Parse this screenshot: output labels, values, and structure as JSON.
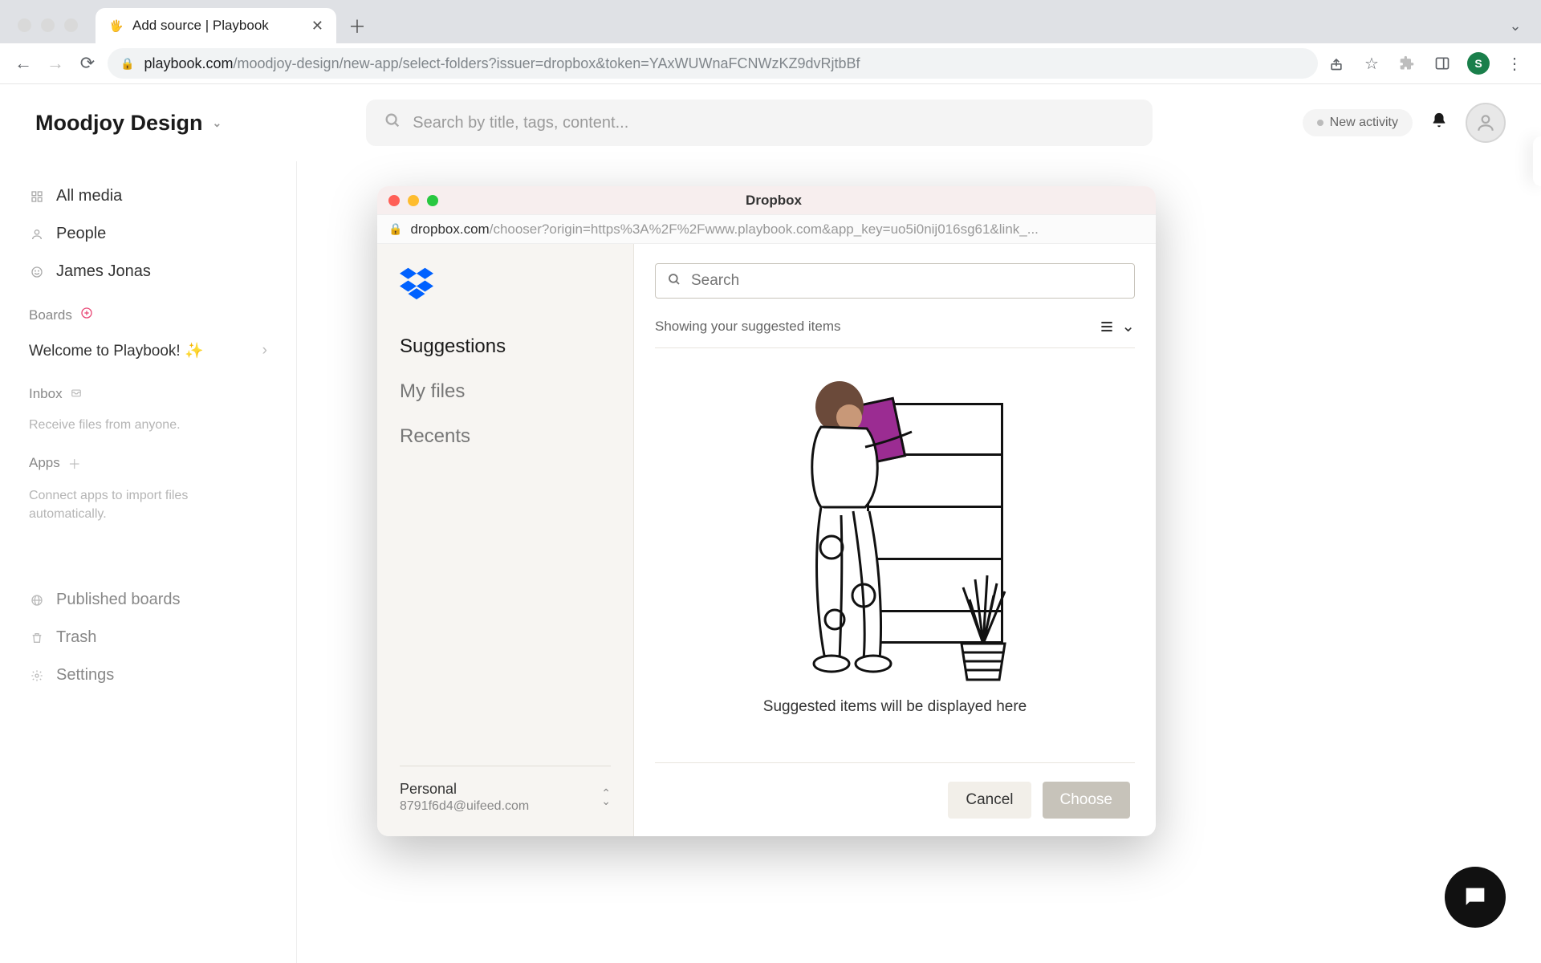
{
  "browser": {
    "tab_title": "Add source | Playbook",
    "url_host": "playbook.com",
    "url_path": "/moodjoy-design/new-app/select-folders?issuer=dropbox&token=YAxWUWnaFCNWzKZ9dvRjtbBf",
    "profile_initial": "S"
  },
  "header": {
    "workspace": "Moodjoy Design",
    "search_placeholder": "Search by title, tags, content...",
    "activity_label": "New activity"
  },
  "sidebar": {
    "items": [
      {
        "icon": "grid",
        "label": "All media"
      },
      {
        "icon": "person",
        "label": "People"
      },
      {
        "icon": "circle",
        "label": "James Jonas"
      }
    ],
    "boards_label": "Boards",
    "board_welcome": "Welcome to Playbook! ✨",
    "inbox_label": "Inbox",
    "inbox_sub": "Receive files from anyone.",
    "apps_label": "Apps",
    "apps_sub": "Connect apps to import files automatically.",
    "bottom": [
      {
        "icon": "globe",
        "label": "Published boards"
      },
      {
        "icon": "trash",
        "label": "Trash"
      },
      {
        "icon": "gear",
        "label": "Settings"
      }
    ]
  },
  "modal": {
    "title": "Dropbox",
    "url_host": "dropbox.com",
    "url_path": "/chooser?origin=https%3A%2F%2Fwww.playbook.com&app_key=uo5i0nij016sg61&link_...",
    "nav": {
      "suggestions": "Suggestions",
      "myfiles": "My files",
      "recents": "Recents"
    },
    "search_placeholder": "Search",
    "list_header": "Showing your suggested items",
    "empty_text": "Suggested items will be displayed here",
    "account_name": "Personal",
    "account_email": "8791f6d4@uifeed.com",
    "cancel_label": "Cancel",
    "choose_label": "Choose"
  }
}
